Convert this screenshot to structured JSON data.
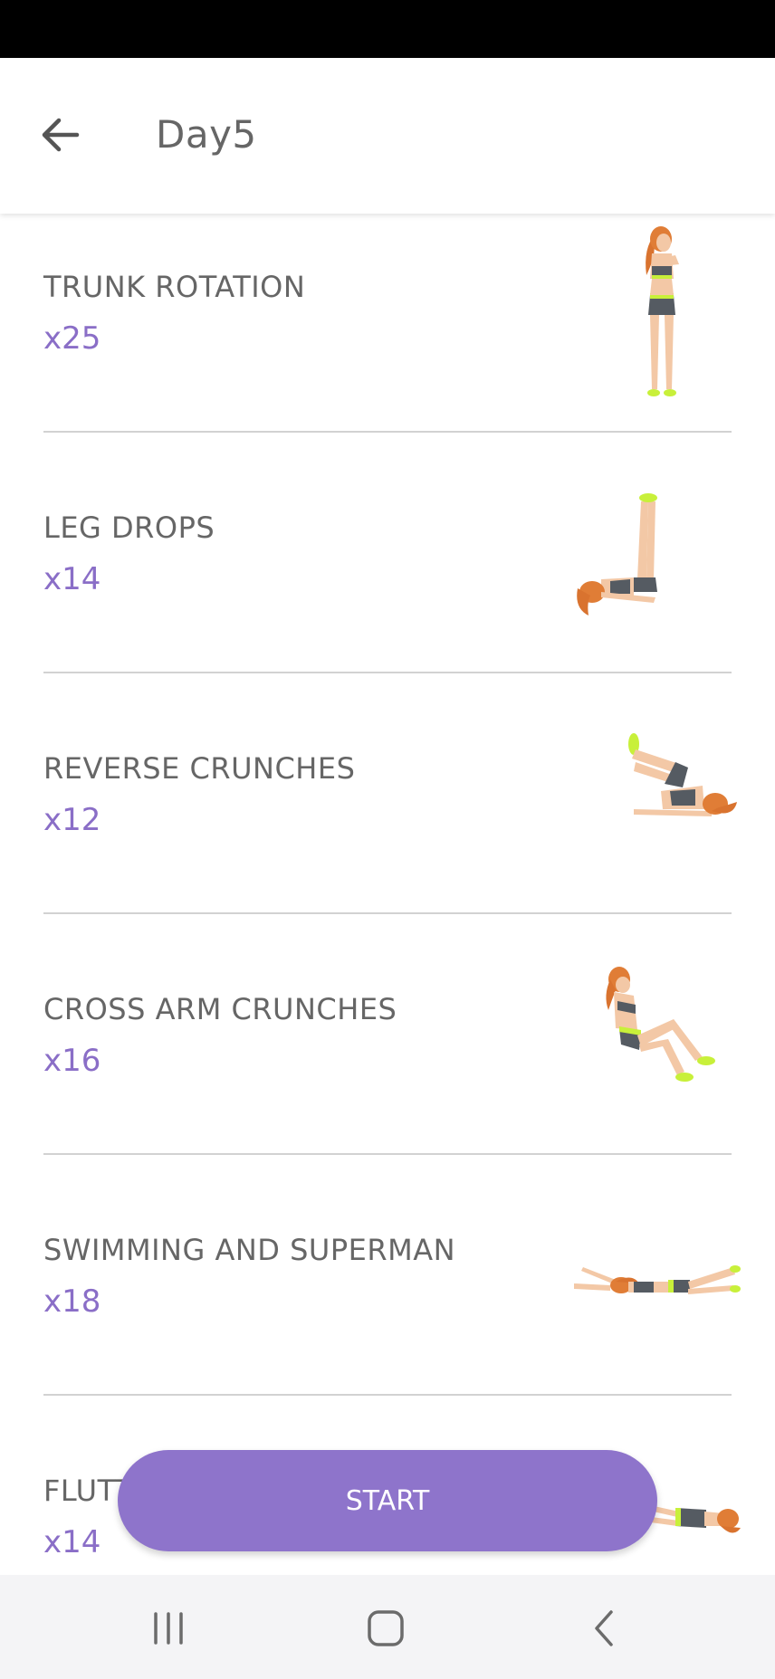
{
  "header": {
    "title": "Day5"
  },
  "exercises": [
    {
      "name": "TRUNK ROTATION",
      "count": "x25",
      "icon": "trunk-rotation-illustration"
    },
    {
      "name": "LEG DROPS",
      "count": "x14",
      "icon": "leg-drops-illustration"
    },
    {
      "name": "REVERSE CRUNCHES",
      "count": "x12",
      "icon": "reverse-crunches-illustration"
    },
    {
      "name": "CROSS ARM CRUNCHES",
      "count": "x16",
      "icon": "cross-arm-crunches-illustration"
    },
    {
      "name": "SWIMMING AND SUPERMAN",
      "count": "x18",
      "icon": "swimming-superman-illustration"
    },
    {
      "name": "FLUTTER KICKS",
      "count": "x14",
      "icon": "flutter-kicks-illustration"
    }
  ],
  "start_button": {
    "label": "START"
  },
  "colors": {
    "accent": "#8e74cb",
    "count_text": "#8a6ec7",
    "title_text": "#666666",
    "neon": "#c8f03a"
  },
  "icons": {
    "back": "arrow-left-icon",
    "recents": "recents-icon",
    "home": "home-icon",
    "nav_back": "chevron-left-icon"
  }
}
